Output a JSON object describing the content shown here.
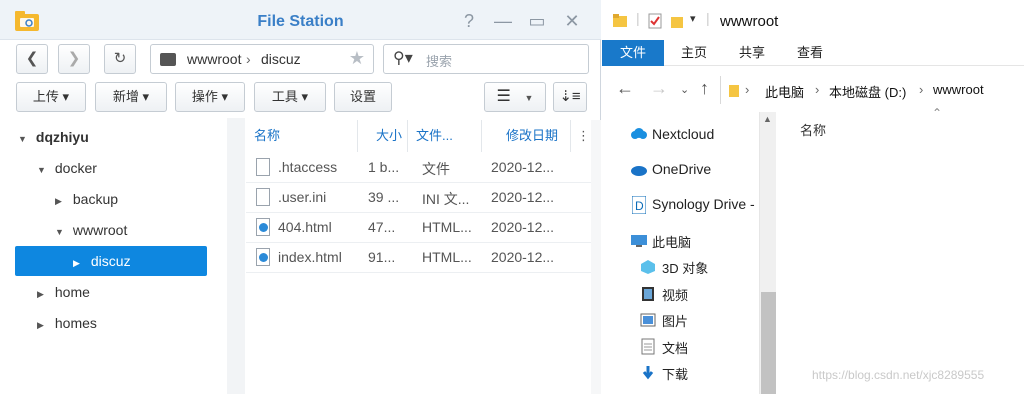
{
  "file_station": {
    "title": "File Station",
    "window_controls": [
      "?",
      "—",
      "▭",
      "✕"
    ],
    "path": {
      "segments": [
        "wwwroot",
        "discuz"
      ]
    },
    "search_placeholder": "搜索",
    "toolbar": {
      "upload": "上传 ▾",
      "create": "新增 ▾",
      "action": "操作 ▾",
      "tools": "工具 ▾",
      "settings": "设置"
    },
    "tree": [
      {
        "label": "dqzhiyu",
        "arrow": "▼",
        "bold": true
      },
      {
        "label": "docker",
        "arrow": "▼"
      },
      {
        "label": "backup",
        "arrow": "▶"
      },
      {
        "label": "wwwroot",
        "arrow": "▼"
      },
      {
        "label": "discuz",
        "arrow": "▶",
        "selected": true
      },
      {
        "label": "home",
        "arrow": "▶"
      },
      {
        "label": "homes",
        "arrow": "▶"
      }
    ],
    "columns": [
      "名称",
      "大小",
      "文件...",
      "修改日期"
    ],
    "files": [
      {
        "name": ".htaccess",
        "size": "1 b...",
        "type": "文件",
        "modified": "2020-12...",
        "icon": "file-icon"
      },
      {
        "name": ".user.ini",
        "size": "39 ...",
        "type": "INI 文...",
        "modified": "2020-12...",
        "icon": "file-icon"
      },
      {
        "name": "404.html",
        "size": "47...",
        "type": "HTML...",
        "modified": "2020-12...",
        "icon": "html-icon"
      },
      {
        "name": "index.html",
        "size": "91...",
        "type": "HTML...",
        "modified": "2020-12...",
        "icon": "html-icon"
      }
    ],
    "colors": {
      "accent": "#0e87e0",
      "title": "#3a7fc7"
    }
  },
  "explorer": {
    "title": "wwwroot",
    "ribbon_tabs": [
      "文件",
      "主页",
      "共享",
      "查看"
    ],
    "address": [
      "此电脑",
      "本地磁盘 (D:)",
      "wwwroot"
    ],
    "nav_items": [
      {
        "label": "Nextcloud",
        "icon": "nextcloud-icon"
      },
      {
        "label": "OneDrive",
        "icon": "onedrive-icon"
      },
      {
        "label": "Synology Drive -",
        "icon": "synology-drive-icon"
      },
      {
        "label": "此电脑",
        "icon": "pc-icon"
      },
      {
        "label": "3D 对象",
        "icon": "3d-objects-icon"
      },
      {
        "label": "视频",
        "icon": "video-icon"
      },
      {
        "label": "图片",
        "icon": "pictures-icon"
      },
      {
        "label": "文档",
        "icon": "documents-icon"
      },
      {
        "label": "下载",
        "icon": "download-icon"
      }
    ],
    "column_header": "名称",
    "watermark": "https://blog.csdn.net/xjc8289555",
    "colors": {
      "ribbon_active": "#1979ca"
    }
  }
}
